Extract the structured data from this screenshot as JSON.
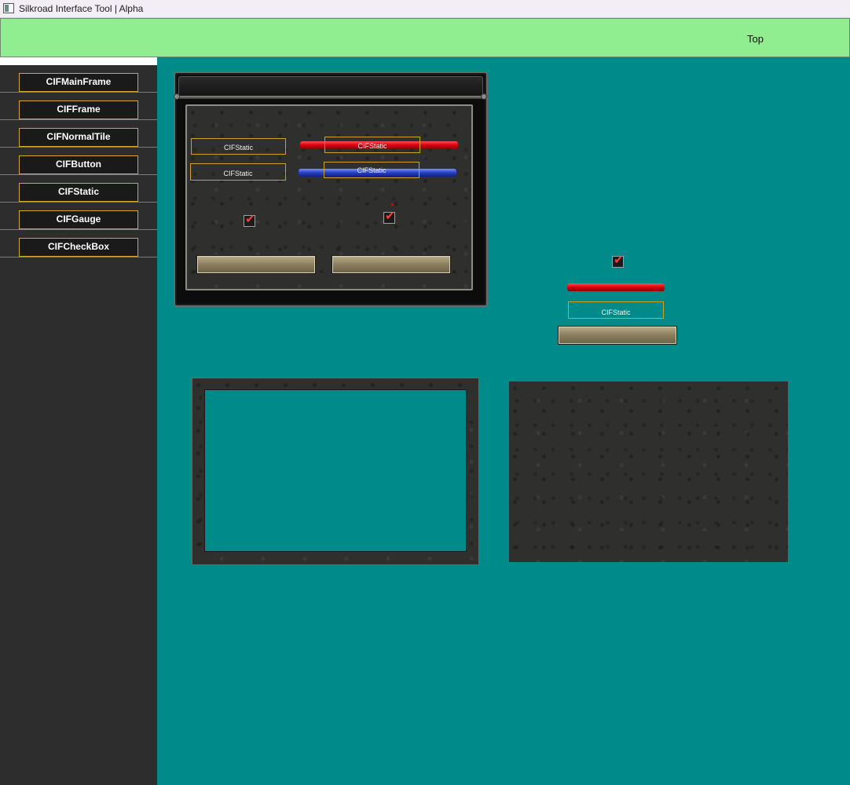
{
  "window": {
    "title": "Silkroad Interface Tool | Alpha",
    "icon": "app-window-icon"
  },
  "top_panel": {
    "label": "Top",
    "color": "#90ee90"
  },
  "sidebar": {
    "items": [
      {
        "label": "CIFMainFrame"
      },
      {
        "label": "CIFFrame"
      },
      {
        "label": "CIFNormalTile"
      },
      {
        "label": "CIFButton"
      },
      {
        "label": "CIFStatic"
      },
      {
        "label": "CIFGauge"
      },
      {
        "label": "CIFCheckBox"
      }
    ]
  },
  "main_frame": {
    "static_1": "CIFStatic",
    "static_2": "CIFStatic",
    "gauge_red_label": "CIFStatic",
    "gauge_blue_label": "CIFStatic",
    "checkbox_1_checked": true,
    "checkbox_2_checked": true
  },
  "floating": {
    "checkbox_checked": true,
    "static_label": "CIFStatic"
  },
  "colors": {
    "canvas": "#008b8a",
    "sidebar": "#2d2d2d",
    "accent_border": "#d7a52a",
    "gauge_red": "#e00010",
    "gauge_blue": "#2d44c8"
  },
  "check_glyph": "✔"
}
